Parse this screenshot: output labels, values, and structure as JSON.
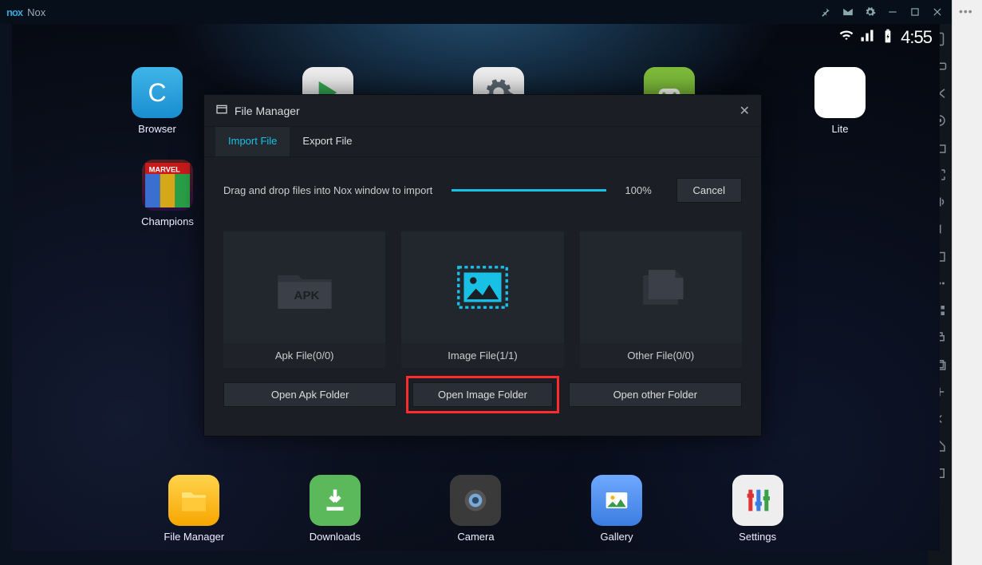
{
  "window": {
    "app_name": "Nox"
  },
  "statusbar": {
    "time": "4:55"
  },
  "apps_top": [
    {
      "name": "browser",
      "label": "Browser"
    },
    {
      "name": "play",
      "label": ""
    },
    {
      "name": "settings",
      "label": ""
    },
    {
      "name": "game",
      "label": ""
    },
    {
      "name": "fb_lite",
      "label": "Lite"
    }
  ],
  "apps_row2": [
    {
      "name": "champions",
      "label": "Champions"
    }
  ],
  "dock": [
    {
      "name": "file_manager",
      "label": "File Manager"
    },
    {
      "name": "downloads",
      "label": "Downloads"
    },
    {
      "name": "camera",
      "label": "Camera"
    },
    {
      "name": "gallery",
      "label": "Gallery"
    },
    {
      "name": "settings",
      "label": "Settings"
    }
  ],
  "dialog": {
    "title": "File Manager",
    "tabs": {
      "import": "Import File",
      "export": "Export File",
      "active": "import"
    },
    "instruction": "Drag and drop files into Nox window to import",
    "progress_pct": "100%",
    "cancel": "Cancel",
    "cards": {
      "apk": {
        "caption": "Apk File(0/0)",
        "open": "Open Apk Folder"
      },
      "image": {
        "caption": "Image File(1/1)",
        "open": "Open Image Folder"
      },
      "other": {
        "caption": "Other File(0/0)",
        "open": "Open other Folder"
      }
    },
    "highlighted_open_button": "image"
  }
}
